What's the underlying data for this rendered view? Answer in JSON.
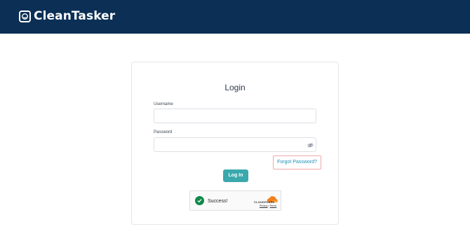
{
  "header": {
    "brand_name": "CleanTasker",
    "bg_color": "#0b2f55",
    "logo_icon": "smile-box-icon"
  },
  "login": {
    "title": "Login",
    "username_label": "Username",
    "username_value": "",
    "password_label": "Password",
    "password_value": "",
    "password_toggle_icon": "eye-slash-icon",
    "forgot_label": "Forgot Password?",
    "submit_label": "Log In",
    "accent_color": "#3aa8ad"
  },
  "captcha": {
    "status_text": "Success!",
    "provider": "CLOUDFLARE",
    "privacy_label": "Privacy",
    "separator": "•",
    "terms_label": "Terms"
  }
}
